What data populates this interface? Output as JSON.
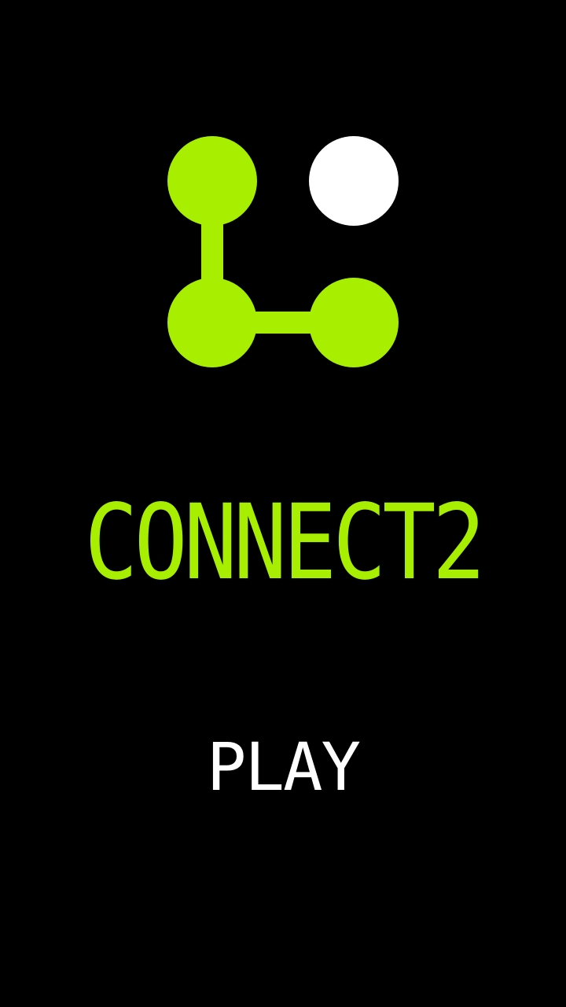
{
  "colors": {
    "background": "#000000",
    "accent": "#A8EE00",
    "node_empty": "#FFFFFF",
    "play_text": "#FFFFFF"
  },
  "logo": {
    "icon": "connected-dots-icon",
    "nodes": [
      {
        "name": "logo-node-top-left",
        "state": "connected"
      },
      {
        "name": "logo-node-top-right",
        "state": "empty"
      },
      {
        "name": "logo-node-bottom-left",
        "state": "connected"
      },
      {
        "name": "logo-node-bottom-right",
        "state": "connected"
      }
    ]
  },
  "title": "CONNECT2",
  "menu": {
    "play_label": "PLAY"
  }
}
